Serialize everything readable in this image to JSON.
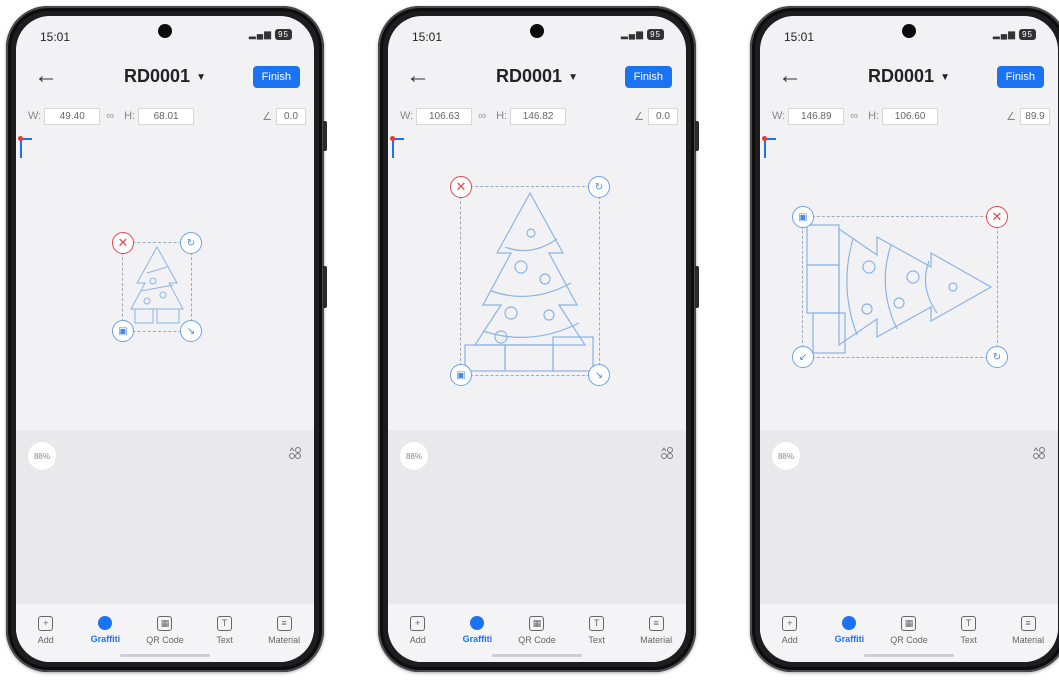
{
  "accent": "#1a73f2",
  "phones": [
    {
      "status": {
        "time": "15:01",
        "battery": "95"
      },
      "nav": {
        "title": "RD0001",
        "finish": "Finish"
      },
      "dims": {
        "w_label": "W:",
        "w": "49.40",
        "h_label": "H:",
        "h": "68.01",
        "angle": "0.0"
      },
      "zoom": "88%",
      "tabs": [
        "Add",
        "Graffiti",
        "QR Code",
        "Text",
        "Material"
      ],
      "active_tab": "Graffiti"
    },
    {
      "status": {
        "time": "15:01",
        "battery": "95"
      },
      "nav": {
        "title": "RD0001",
        "finish": "Finish"
      },
      "dims": {
        "w_label": "W:",
        "w": "106.63",
        "h_label": "H:",
        "h": "146.82",
        "angle": "0.0"
      },
      "zoom": "88%",
      "tabs": [
        "Add",
        "Graffiti",
        "QR Code",
        "Text",
        "Material"
      ],
      "active_tab": "Graffiti"
    },
    {
      "status": {
        "time": "15:01",
        "battery": "95"
      },
      "nav": {
        "title": "RD0001",
        "finish": "Finish"
      },
      "dims": {
        "w_label": "W:",
        "w": "146.89",
        "h_label": "H:",
        "h": "106.60",
        "angle": "89.9"
      },
      "zoom": "88%",
      "tabs": [
        "Add",
        "Graffiti",
        "QR Code",
        "Text",
        "Material"
      ],
      "active_tab": "Graffiti"
    }
  ]
}
